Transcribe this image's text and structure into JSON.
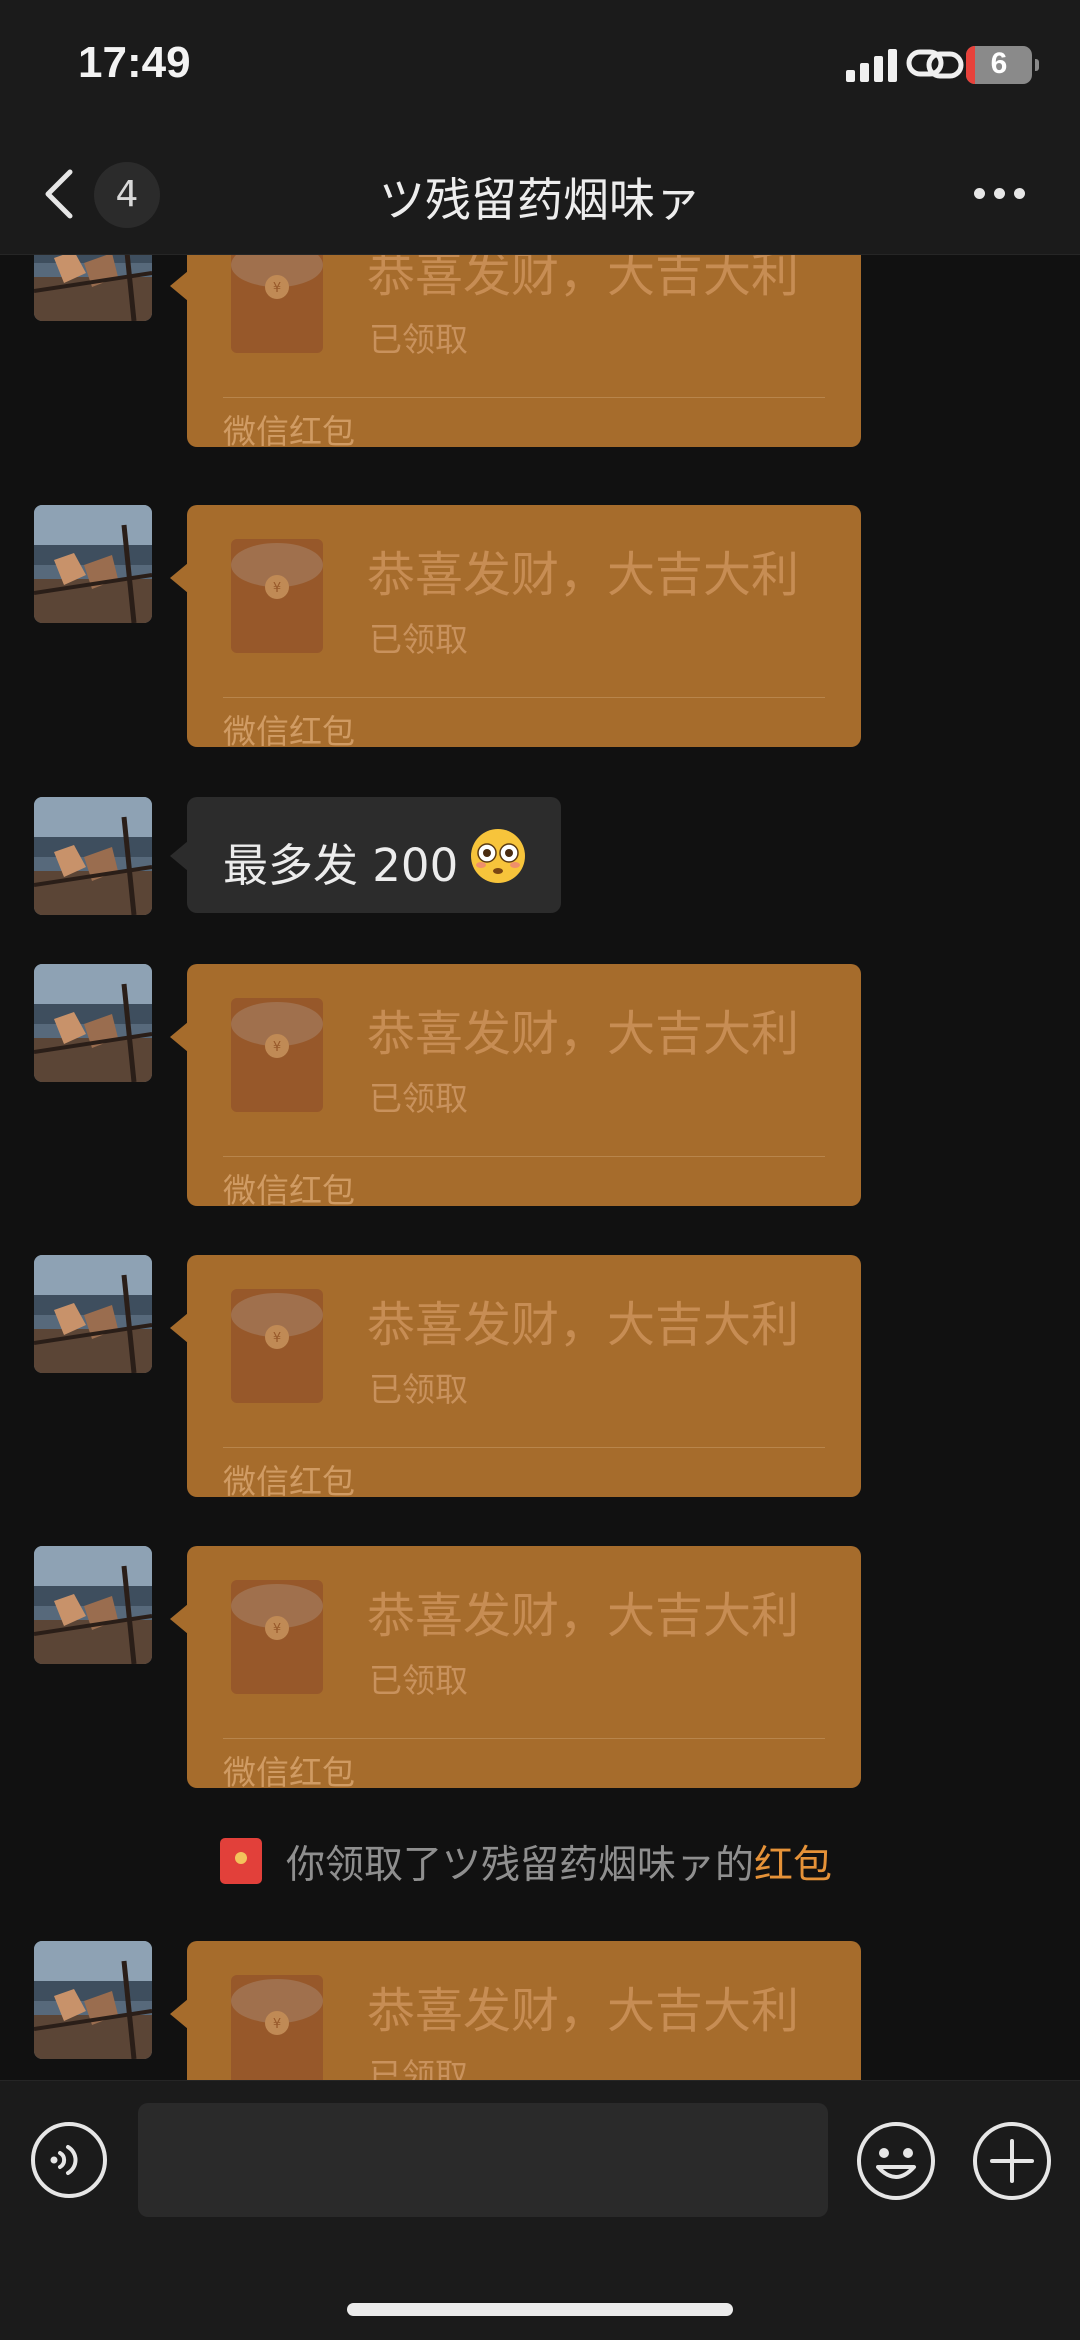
{
  "status_bar": {
    "time": "17:49",
    "battery": "6"
  },
  "header": {
    "unread_count": "4",
    "title": "ツ残留药烟味ァ"
  },
  "messages": [
    {
      "type": "red_packet",
      "greeting": "恭喜发财，大吉大利",
      "status": "已领取",
      "label": "微信红包"
    },
    {
      "type": "red_packet",
      "greeting": "恭喜发财，大吉大利",
      "status": "已领取",
      "label": "微信红包"
    },
    {
      "type": "text",
      "text": "最多发 200"
    },
    {
      "type": "red_packet",
      "greeting": "恭喜发财，大吉大利",
      "status": "已领取",
      "label": "微信红包"
    },
    {
      "type": "red_packet",
      "greeting": "恭喜发财，大吉大利",
      "status": "已领取",
      "label": "微信红包"
    },
    {
      "type": "red_packet",
      "greeting": "恭喜发财，大吉大利",
      "status": "已领取",
      "label": "微信红包"
    },
    {
      "type": "system",
      "prefix": "你领取了ツ残留药烟味ァ的",
      "link": "红包"
    },
    {
      "type": "red_packet",
      "greeting": "恭喜发财，大吉大利",
      "status": "已领取",
      "label": ""
    }
  ],
  "input": {
    "placeholder": ""
  },
  "colors": {
    "background": "#111111",
    "red_packet": "#a66c2c",
    "text_bubble": "#2c2c2c",
    "link": "#e59238"
  }
}
